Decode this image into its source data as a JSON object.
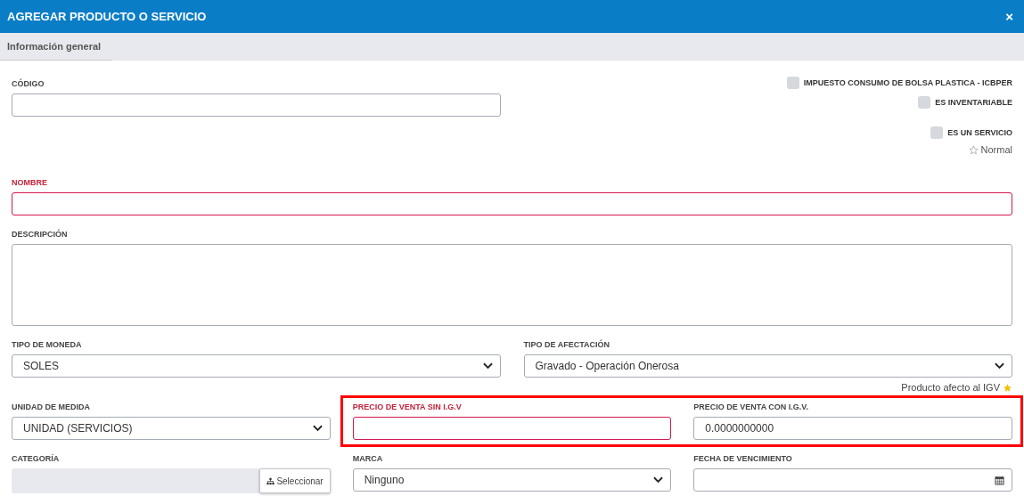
{
  "header": {
    "title": "AGREGAR PRODUCTO O SERVICIO",
    "close": "×"
  },
  "tabs": [
    {
      "label": "Información general",
      "selected": true
    }
  ],
  "codigo": {
    "label": "CÓDIGO",
    "required": false
  },
  "options": [
    {
      "label": "IMPUESTO CONSUMO DE BOLSA PLASTICA - ICBPER",
      "checked": false
    },
    {
      "label": "ES INVENTARIABLE",
      "checked": false
    },
    {
      "label": "ES UN SERVICIO",
      "checked": false
    }
  ],
  "rating": {
    "label": "Normal",
    "starred": false
  },
  "nombre": {
    "label": "NOMBRE",
    "required": true
  },
  "descripcion": {
    "label": "DESCRIPCIÓN",
    "required": false
  },
  "row1": [
    {
      "label": "TIPO DE MONEDA",
      "kind": "select",
      "value": "SOLES",
      "required": false
    },
    {
      "label": "TIPO DE AFECTACIÓN",
      "kind": "select",
      "value": "Gravado - Operación Onerosa",
      "required": false
    }
  ],
  "igv_note": {
    "text": "Producto afecto al IGV"
  },
  "row2": [
    {
      "label": "UNIDAD DE MEDIDA",
      "kind": "select",
      "value": "UNIDAD (SERVICIOS)",
      "required": false
    },
    {
      "label": "PRECIO DE VENTA SIN I.G.V",
      "kind": "input",
      "required": true,
      "highlighted": true
    },
    {
      "label": "PRECIO DE VENTA CON I.G.V.",
      "kind": "input",
      "value": "0.0000000000",
      "required": false,
      "highlighted": true
    }
  ],
  "row3": [
    {
      "label": "CATEGORÍA",
      "kind": "picker",
      "button": "Seleccionar",
      "required": false
    },
    {
      "label": "MARCA",
      "kind": "select",
      "value": "Ninguno",
      "required": false
    },
    {
      "label": "FECHA DE VENCIMIENTO",
      "kind": "date",
      "required": false
    }
  ]
}
